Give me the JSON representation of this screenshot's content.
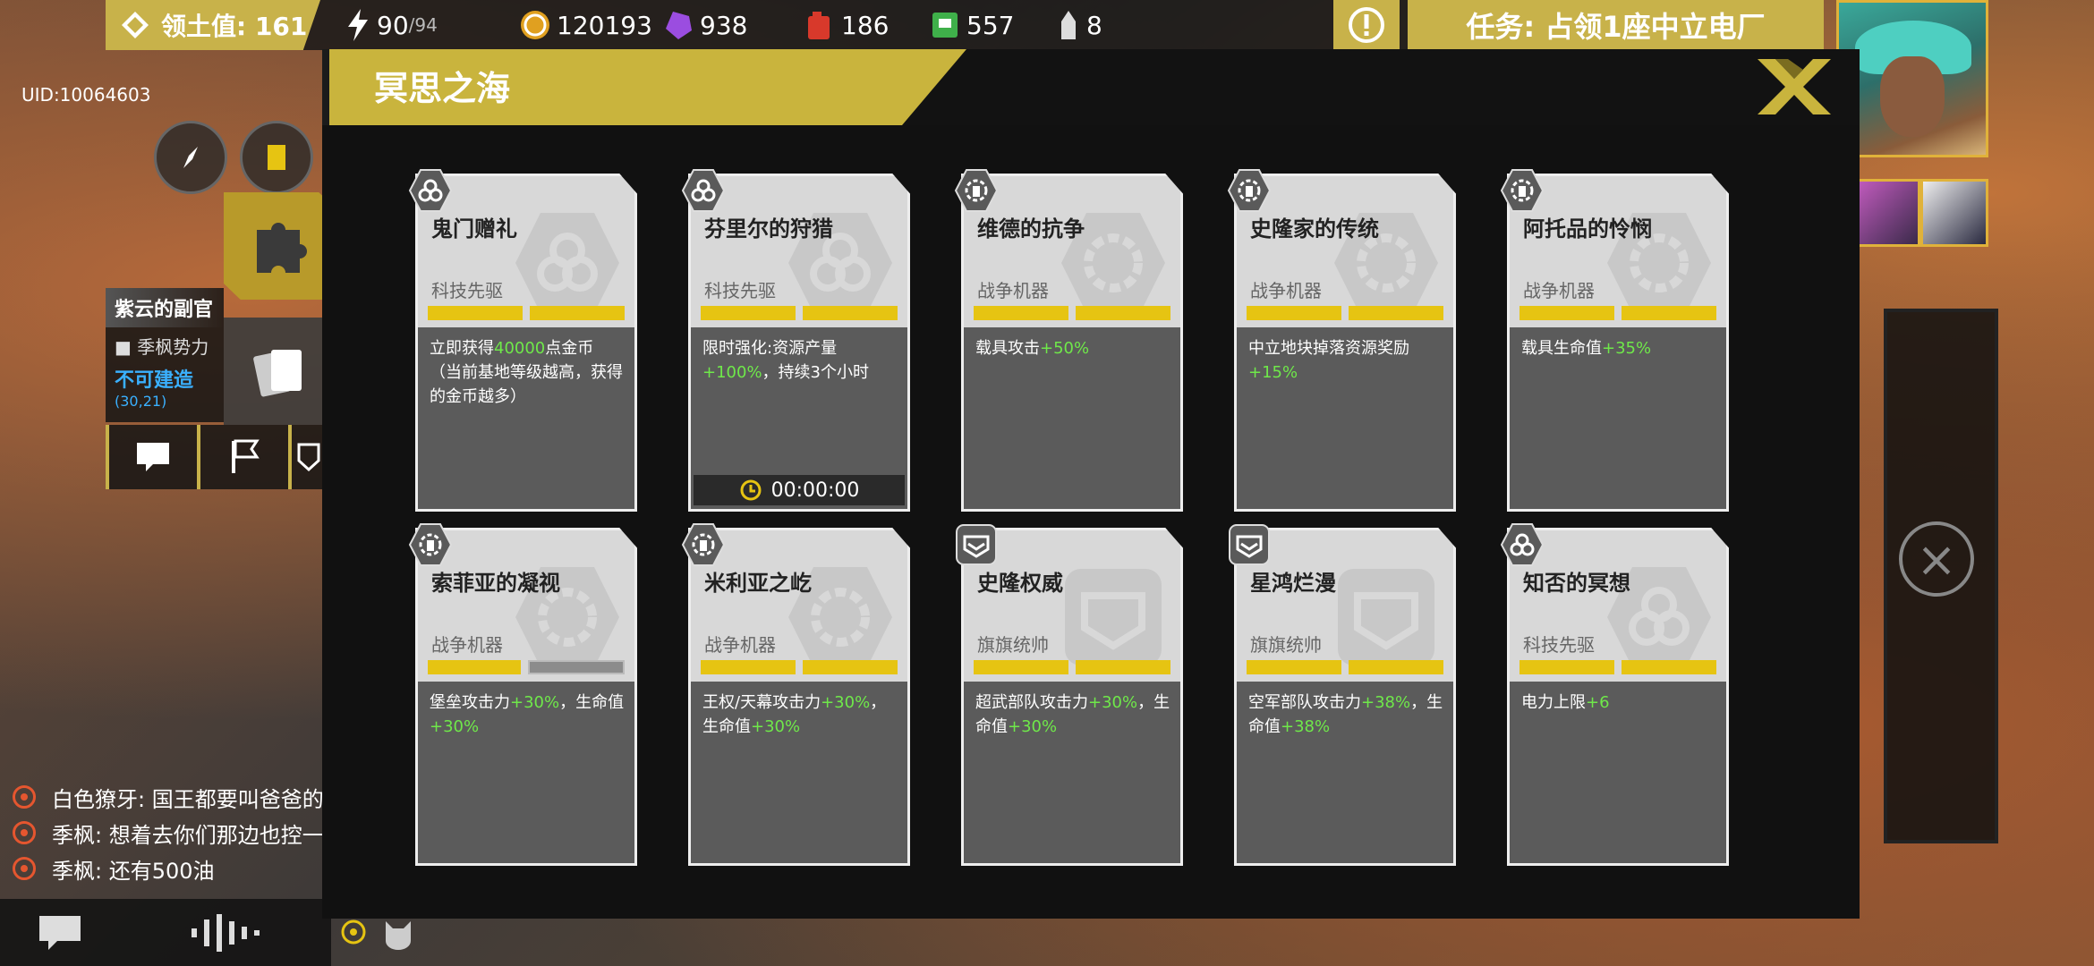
{
  "topbar": {
    "territory_label": "领土值: 161",
    "energy": "90",
    "energy_max": "/94",
    "gold": "120193",
    "crystal": "938",
    "fuel": "186",
    "chips": "557",
    "ammo": "8",
    "task": "任务: 占领1座中立电厂"
  },
  "uid": "UID:10064603",
  "side_info": {
    "name": "紫云的副官",
    "faction": "■ 季枫势力",
    "build_status": "不可建造",
    "coords": "(30,21)"
  },
  "chat": [
    {
      "speaker": "白色獠牙",
      "text": "白色獠牙: 国王都要叫爸爸的"
    },
    {
      "speaker": "季枫",
      "text": "季枫: 想着去你们那边也控一"
    },
    {
      "speaker": "季枫",
      "text": "季枫: 还有500油"
    }
  ],
  "modal": {
    "title": "冥思之海"
  },
  "cards": [
    {
      "name": "鬼门赠礼",
      "type": "科技先驱",
      "badge": "tech-icon",
      "bars": [
        1,
        1
      ],
      "desc_a": "立即获得",
      "desc_g": "40000",
      "desc_b": "点金币（当前基地等级越高，获得的金币越多）",
      "timer": ""
    },
    {
      "name": "芬里尔的狩猎",
      "type": "科技先驱",
      "badge": "tech-icon",
      "bars": [
        1,
        1
      ],
      "desc_a": "限时强化:资源产量",
      "desc_g": "+100%",
      "desc_b": "，持续3个小时",
      "timer": "00:00:00"
    },
    {
      "name": "维德的抗争",
      "type": "战争机器",
      "badge": "war-icon",
      "bars": [
        1,
        1
      ],
      "desc_a": "载具攻击",
      "desc_g": "+50%",
      "desc_b": "",
      "timer": ""
    },
    {
      "name": "史隆家的传统",
      "type": "战争机器",
      "badge": "war-icon",
      "bars": [
        1,
        1
      ],
      "desc_a": "中立地块掉落资源奖励",
      "desc_g": "+15%",
      "desc_b": "",
      "timer": ""
    },
    {
      "name": "阿托品的怜悯",
      "type": "战争机器",
      "badge": "war-icon",
      "bars": [
        1,
        1
      ],
      "desc_a": "载具生命值",
      "desc_g": "+35%",
      "desc_b": "",
      "timer": ""
    },
    {
      "name": "索菲亚的凝视",
      "type": "战争机器",
      "badge": "war-icon",
      "bars": [
        1,
        0
      ],
      "desc_a": "堡垒攻击力",
      "desc_g": "+30%",
      "desc_b": "，生命值",
      "desc_g2": "+30%",
      "timer": ""
    },
    {
      "name": "米利亚之屹",
      "type": "战争机器",
      "badge": "war-icon",
      "bars": [
        1,
        1
      ],
      "desc_a": "王权/天幕攻击力",
      "desc_g": "+30%",
      "desc_b": "，生命值",
      "desc_g2": "+30%",
      "timer": ""
    },
    {
      "name": "史隆权威",
      "type": "旗旗统帅",
      "badge": "commander-icon",
      "bars": [
        1,
        1
      ],
      "desc_a": "超武部队攻击力",
      "desc_g": "+30%",
      "desc_b": "，生命值",
      "desc_g2": "+30%",
      "timer": ""
    },
    {
      "name": "星鸿烂漫",
      "type": "旗旗统帅",
      "badge": "commander-icon",
      "bars": [
        1,
        1
      ],
      "desc_a": "空军部队攻击力",
      "desc_g": "+38%",
      "desc_b": "，生命值",
      "desc_g2": "+38%",
      "timer": ""
    },
    {
      "name": "知否的冥想",
      "type": "科技先驱",
      "badge": "tech-icon",
      "bars": [
        1,
        1
      ],
      "desc_a": "电力上限",
      "desc_g": "+6",
      "desc_b": "",
      "timer": ""
    }
  ],
  "colors": {
    "accent": "#c9b43d",
    "progress": "#e6c412",
    "bonus": "#6fe84a",
    "link": "#3ab0ff"
  }
}
